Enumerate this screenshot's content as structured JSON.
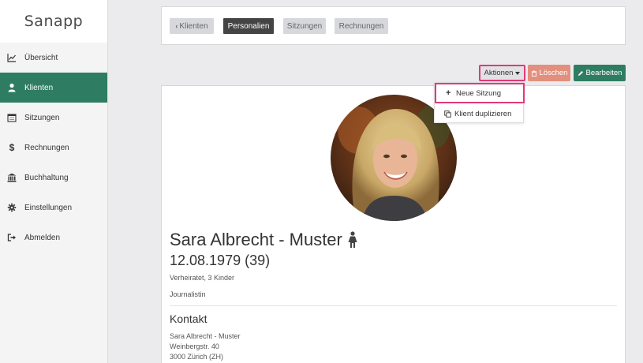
{
  "app": {
    "logo": "Sanapp"
  },
  "sidebar": {
    "items": [
      {
        "label": "Übersicht",
        "icon": "chart-line-icon",
        "active": false
      },
      {
        "label": "Klienten",
        "icon": "user-icon",
        "active": true
      },
      {
        "label": "Sitzungen",
        "icon": "calendar-icon",
        "active": false
      },
      {
        "label": "Rechnungen",
        "icon": "dollar-icon",
        "active": false
      },
      {
        "label": "Buchhaltung",
        "icon": "bank-icon",
        "active": false
      },
      {
        "label": "Einstellungen",
        "icon": "gear-icon",
        "active": false
      },
      {
        "label": "Abmelden",
        "icon": "sign-out-icon",
        "active": false
      }
    ]
  },
  "tabs": {
    "back": "Klienten",
    "personalien": "Personalien",
    "sitzungen": "Sitzungen",
    "rechnungen": "Rechnungen"
  },
  "actions": {
    "aktionen": "Aktionen",
    "loeschen": "Löschen",
    "bearbeiten": "Bearbeiten"
  },
  "dropdown": {
    "neue_sitzung": "Neue Sitzung",
    "duplizieren": "Klient duplizieren"
  },
  "client": {
    "name": "Sara Albrecht - Muster",
    "dob": "12.08.1979 (39)",
    "marital": "Verheiratet, 3 Kinder",
    "job": "Journalistin"
  },
  "contact": {
    "heading": "Kontakt",
    "line1": "Sara Albrecht - Muster",
    "line2": "Weinbergstr. 40",
    "line3": "3000 Zürich (ZH)"
  },
  "colors": {
    "brand": "#2e7d62",
    "danger": "#e38f7e",
    "highlight": "#e03a7a"
  }
}
